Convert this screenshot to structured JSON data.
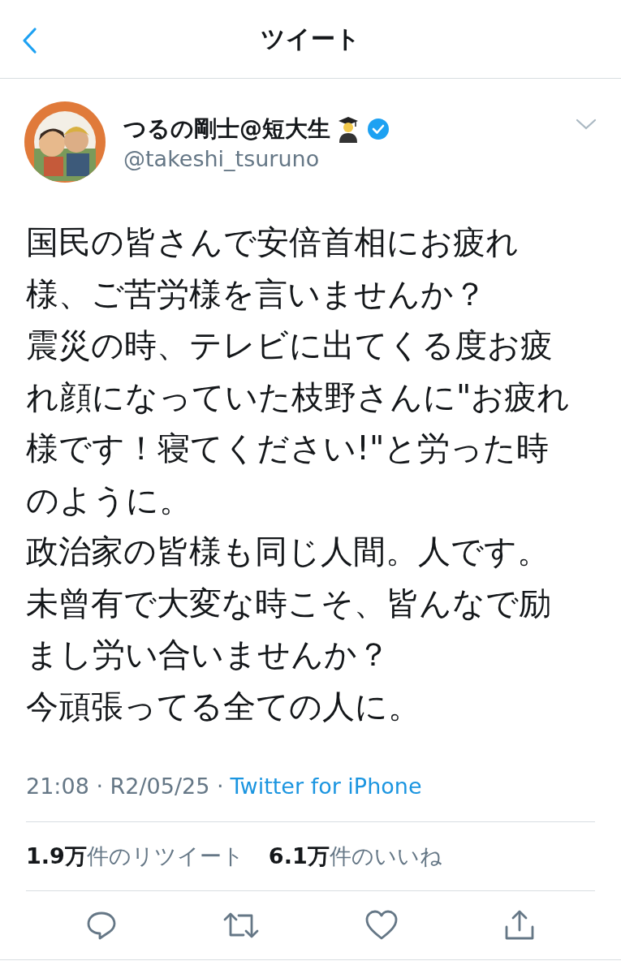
{
  "header": {
    "title": "ツイート"
  },
  "tweet": {
    "author": {
      "name": "つるの剛士@短大生",
      "handle": "@takeshi_tsuruno",
      "verified": true
    },
    "body_lines": [
      "国民の皆さんで安倍首相にお疲れ",
      "様、ご苦労様を言いませんか？",
      "震災の時、テレビに出てくる度お疲",
      "れ顔になっていた枝野さんに\"お疲れ",
      "様です！寝てください!\"と労った時",
      "のように。",
      "政治家の皆様も同じ人間。人です。",
      "未曾有で大変な時こそ、皆んなで励",
      "まし労い合いませんか？",
      "今頑張ってる全ての人に。"
    ],
    "timestamp": "21:08 · R2/05/25 ·",
    "source": "Twitter for iPhone",
    "stats": [
      "**1.9万**件のリツイート",
      "**6.1万**件のいいね"
    ]
  }
}
